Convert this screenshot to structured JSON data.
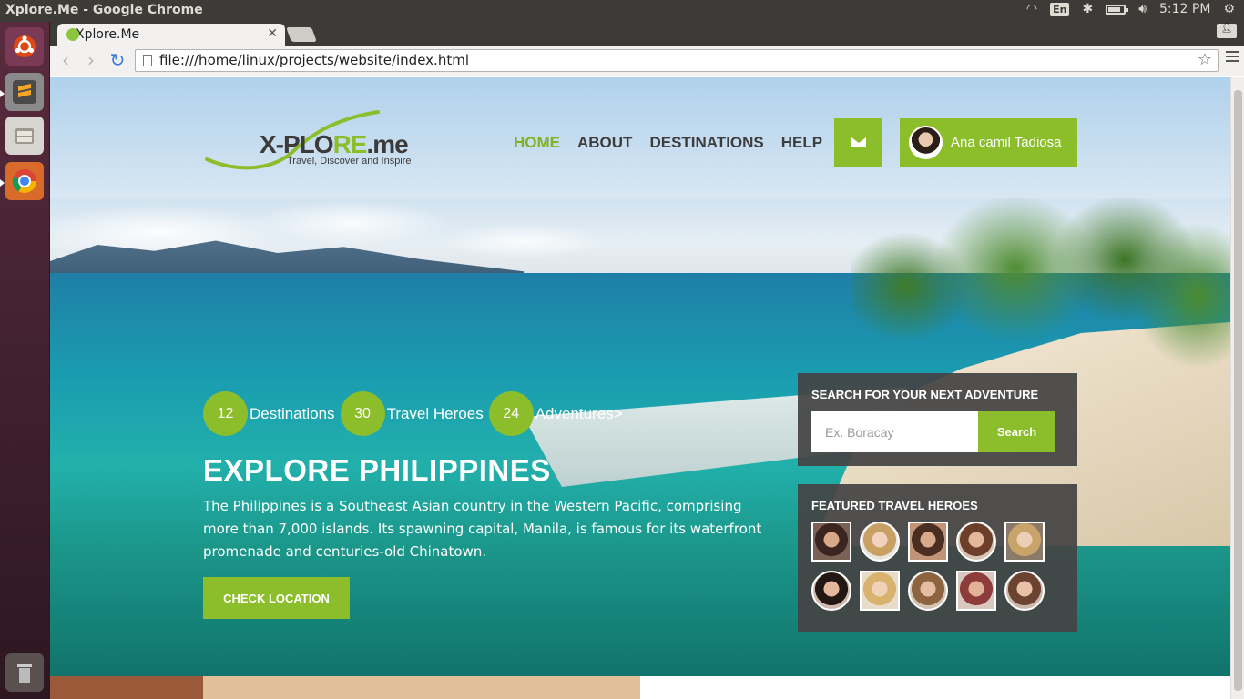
{
  "os": {
    "window_title": "Xplore.Me - Google Chrome",
    "lang": "En",
    "time": "5:12 PM"
  },
  "browser": {
    "tab_title": "Xplore.Me",
    "url": "file:///home/linux/projects/website/index.html"
  },
  "site": {
    "logo": {
      "brand_prefix": "X-PLO",
      "brand_green": "RE",
      "brand_suffix": ".me",
      "tagline": "Travel, Discover and Inspire"
    },
    "nav": [
      "HOME",
      "ABOUT",
      "DESTINATIONS",
      "HELP"
    ],
    "user_name": "Ana camil Tadiosa",
    "stats": [
      {
        "value": "12",
        "label": "Destinations"
      },
      {
        "value": "30",
        "label": "Travel Heroes"
      },
      {
        "value": "24",
        "label": "Adventures>"
      }
    ],
    "hero_title": "EXPLORE PHILIPPINES",
    "hero_description": "The Philippines is a Southeast Asian country in the Western Pacific, comprising more than 7,000 islands. Its spawning capital, Manila, is famous for its waterfront promenade and centuries-old Chinatown.",
    "cta_label": "CHECK LOCATION",
    "search": {
      "title": "SEARCH FOR YOUR NEXT ADVENTURE",
      "placeholder": "Ex. Boracay",
      "button": "Search"
    },
    "featured": {
      "title": "FEATURED TRAVEL HEROES"
    }
  },
  "colors": {
    "accent": "#8cbd2a",
    "panel": "#444444",
    "nav_text": "#3d3d3d"
  }
}
